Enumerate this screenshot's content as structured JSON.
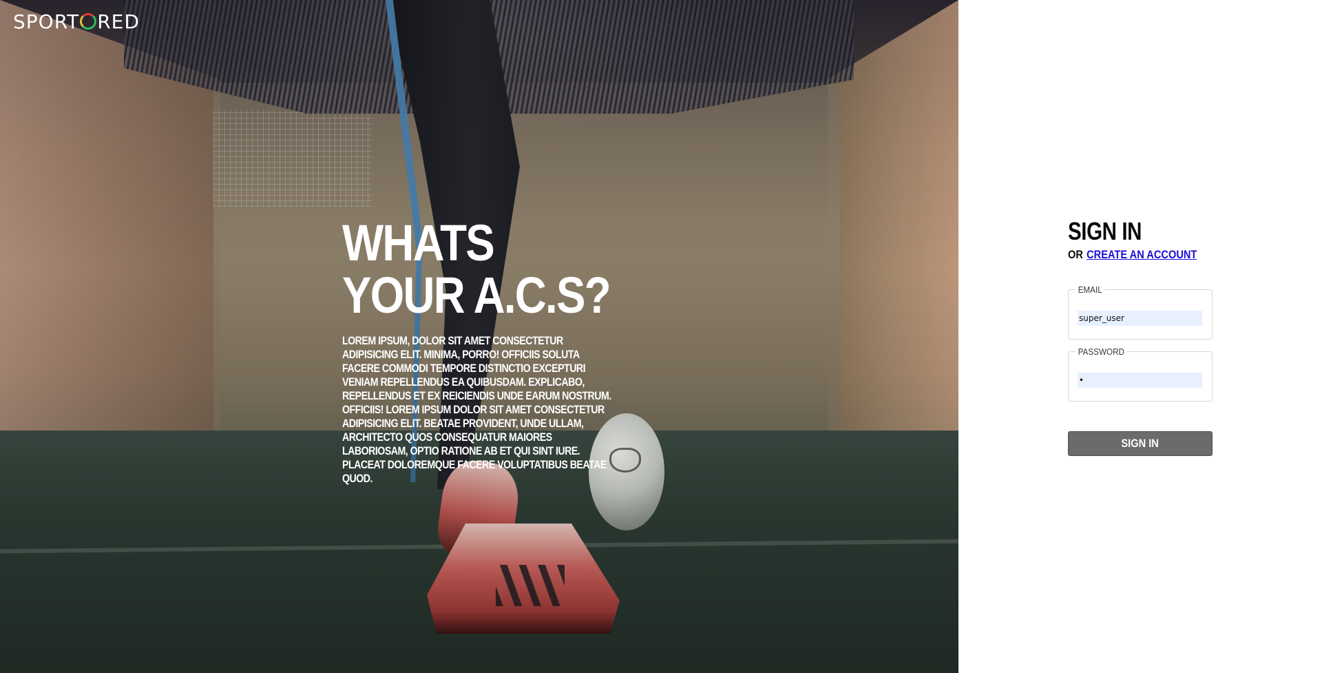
{
  "brand": {
    "logo_before": "SPORT",
    "logo_after": "RED",
    "logo_colors": [
      "#e23a2f",
      "#2bbf5c",
      "#e2c33a"
    ]
  },
  "hero": {
    "title": "WHATS YOUR A.C.S?",
    "body": "LOREM IPSUM, DOLOR SIT AMET CONSECTETUR ADIPISICING ELIT. MINIMA, PORRO! OFFICIIS SOLUTA FACERE COMMODI TEMPORE DISTINCTIO EXCEPTURI VENIAM REPELLENDUS EA QUIBUSDAM. EXPLICABO, REPELLENDUS ET EX REICIENDIS UNDE EARUM NOSTRUM. OFFICIIS! LOREM IPSUM DOLOR SIT AMET CONSECTETUR ADIPISICING ELIT. BEATAE PROVIDENT, UNDE ULLAM, ARCHITECTO QUOS CONSEQUATUR MAIORES LABORIOSAM, OPTIO RATIONE AB ET QUI SINT IURE. PLACEAT DOLOREMQUE FACERE VOLUPTATIBUS BEATAE QUOD."
  },
  "signin": {
    "title": "SIGN IN",
    "or_text": "OR",
    "create_account_label": "CREATE AN ACCOUNT",
    "email_label": "EMAIL",
    "email_value": "super_user",
    "password_label": "PASSWORD",
    "password_value": "•",
    "submit_label": "SIGN IN"
  },
  "colors": {
    "link": "#1a0dd8",
    "button": "#6a6b6c",
    "autofill": "#e8f0fe"
  }
}
